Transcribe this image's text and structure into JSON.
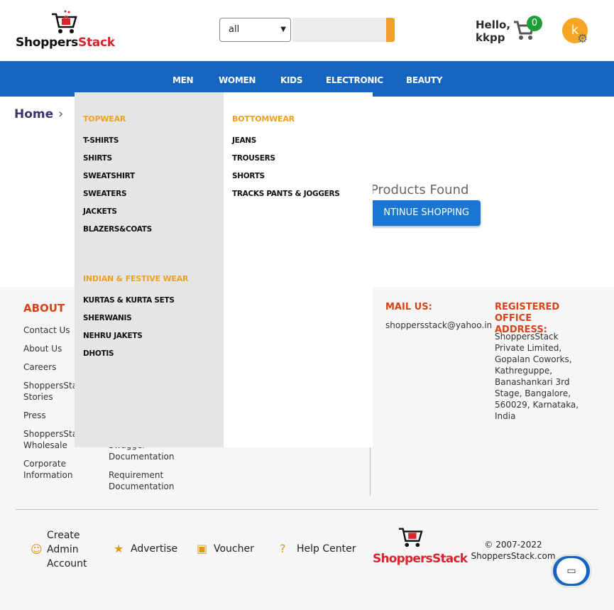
{
  "header": {
    "logo_text_a": "Shoppers",
    "logo_text_b": "Stack",
    "search_category": "all",
    "search_placeholder": "",
    "greeting_line1": "Hello,",
    "greeting_line2": "kkpp",
    "cart_count": "0",
    "avatar_initial": "k"
  },
  "nav": {
    "items": [
      "MEN",
      "WOMEN",
      "KIDS",
      "ELECTRONIC",
      "BEAUTY"
    ]
  },
  "main": {
    "breadcrumb_home": "Home",
    "no_products": "Products Found",
    "continue_label": "NTINUE SHOPPING"
  },
  "mega_menu": {
    "col1_head": "TOPWEAR",
    "col1_items": [
      "T-SHIRTS",
      "SHIRTS",
      "SWEATSHIRT",
      "SWEATERS",
      "JACKETS",
      "BLAZERS&COATS"
    ],
    "col1_head2": "INDIAN & FESTIVE WEAR",
    "col1_items2": [
      "KURTAS & KURTA SETS",
      "SHERWANIS",
      "NEHRU JAKETS",
      "DHOTIS"
    ],
    "col2_head": "BOTTOMWEAR",
    "col2_items": [
      "JEANS",
      "TROUSERS",
      "SHORTS",
      "TRACKS PANTS & JOGGERS"
    ]
  },
  "footer": {
    "about_head": "ABOUT",
    "about_links": [
      "Contact Us",
      "About Us",
      "Careers",
      "ShoppersStack Stories",
      "Press",
      "ShoppersStack Wholesale",
      "Corporate Information"
    ],
    "docs_partial": "Swagger Documentation",
    "docs_req": "Requirement Documentation",
    "mail_head": "MAIL US:",
    "mail_value": "shoppersstack@yahoo.in",
    "office_head": "REGISTERED OFFICE ADDRESS:",
    "office_value": "ShoppersStack Private Limited, Gopalan Coworks, Kathreguppe, Banashankari 3rd Stage, Bangalore, 560029, Karnataka, India",
    "bottom": {
      "create_admin": "Create Admin Account",
      "advertise": "Advertise",
      "voucher": "Voucher",
      "help_center": "Help Center",
      "copyright": "© 2007-2022 ShoppersStack.com"
    }
  }
}
